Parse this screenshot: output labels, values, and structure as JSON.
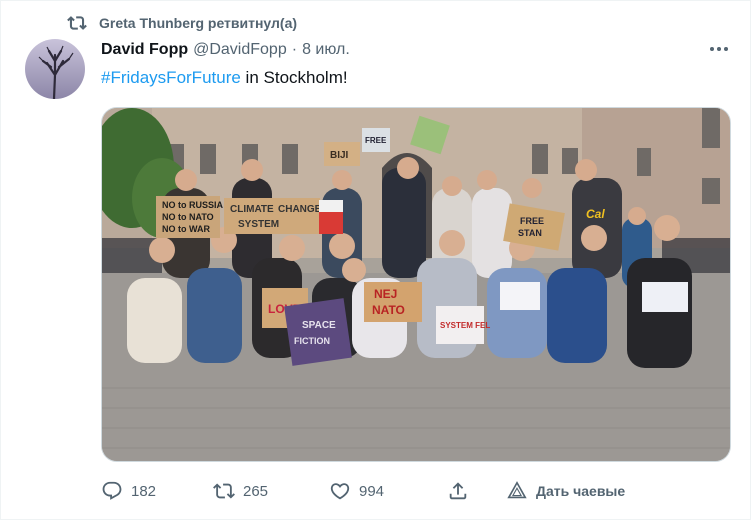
{
  "retweet": {
    "text": "Greta Thunberg ретвитнул(а)"
  },
  "author": {
    "name": "David Fopp",
    "handle": "@DavidFopp",
    "separator": "·",
    "date": "8 июл."
  },
  "tweet": {
    "hashtag": "#FridaysForFuture",
    "rest": " in Stockholm!"
  },
  "signs": {
    "no_russia": "NO to RUSSIA",
    "no_nato": "NO to NATO",
    "no_war": "NO to WAR",
    "climate": "CLIMATE",
    "change": "CHANGE",
    "system": "SYSTEM",
    "free": "FREE",
    "bikini": "BIJI",
    "free_stan": "FREE",
    "stan": "STAN",
    "love": "LOVE",
    "nej": "NEJ",
    "nato": "NATO",
    "space": "SPACE",
    "fiction": "FICTION",
    "system_fel": "SYSTEM FEL",
    "cal": "Cal"
  },
  "actions": {
    "replies": "182",
    "retweets": "265",
    "likes": "994",
    "tip": "Дать чаевые"
  },
  "colors": {
    "accent": "#1d9bf0",
    "muted": "#536471"
  }
}
